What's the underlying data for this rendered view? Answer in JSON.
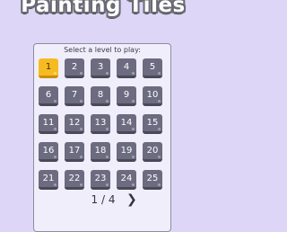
{
  "title": "Painting Tiles",
  "prompt": "Select a level to play:",
  "levels": [
    "1",
    "2",
    "3",
    "4",
    "5",
    "6",
    "7",
    "8",
    "9",
    "10",
    "11",
    "12",
    "13",
    "14",
    "15",
    "16",
    "17",
    "18",
    "19",
    "20",
    "21",
    "22",
    "23",
    "24",
    "25"
  ],
  "selected_level": "1",
  "pager": {
    "text": "1 / 4",
    "next_icon": "chevron-right-icon"
  },
  "colors": {
    "background": "#ddd6f6",
    "tile": "#6d6b80",
    "selected_tile": "#f7bb22"
  }
}
